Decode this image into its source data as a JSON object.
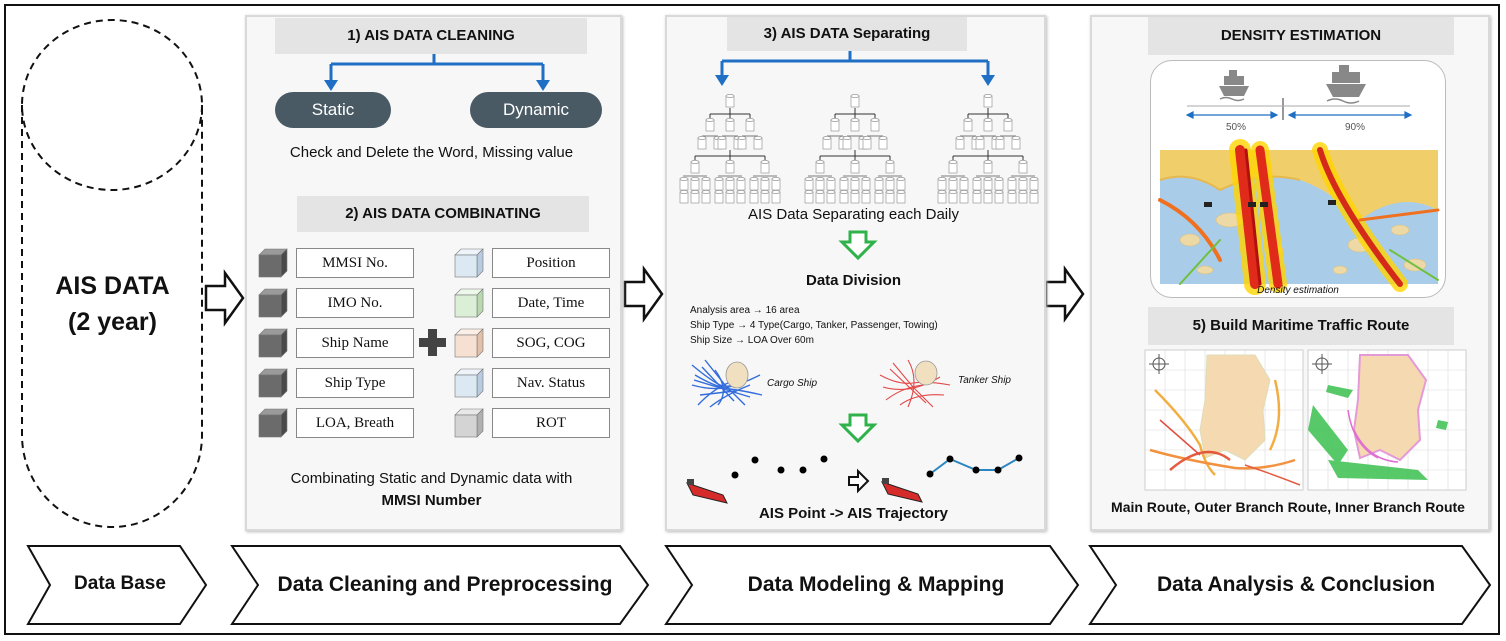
{
  "database": {
    "title_line1": "AIS DATA",
    "title_line2": "(2 year)"
  },
  "step1": {
    "header": "1)   AIS DATA CLEANING",
    "static_label": "Static",
    "dynamic_label": "Dynamic",
    "note": "Check and Delete the Word, Missing value"
  },
  "step2": {
    "header": "2) AIS DATA COMBINATING",
    "static_fields": [
      "MMSI No.",
      "IMO No.",
      "Ship Name",
      "Ship Type",
      "LOA, Breath"
    ],
    "dynamic_fields": [
      "Position",
      "Date, Time",
      "SOG, COG",
      "Nav. Status",
      "ROT"
    ],
    "footer_line1": "Combinating Static and Dynamic data with",
    "footer_line2": "MMSI Number"
  },
  "step3": {
    "header": "3) AIS DATA Separating",
    "tree_caption": "AIS Data Separating each Daily",
    "division_title": "Data Division",
    "division_lines": [
      "Analysis area → 16 area",
      "Ship Type → 4 Type(Cargo, Tanker, Passenger, Towing)",
      "Ship Size → LOA Over 60m"
    ],
    "cargo_label": "Cargo Ship",
    "tanker_label": "Tanker Ship",
    "trajectory_caption": "AIS Point -> AIS Trajectory"
  },
  "step4": {
    "header": "DENSITY ESTIMATION",
    "pct_left": "50%",
    "pct_right": "90%",
    "map_caption": "Density estimation"
  },
  "step5": {
    "header": "5) Build Maritime Traffic Route",
    "caption": "Main Route, Outer Branch Route, Inner Branch Route"
  },
  "stages": [
    "Data Base",
    "Data Cleaning and Preprocessing",
    "Data Modeling & Mapping",
    "Data Analysis & Conclusion"
  ],
  "colors": {
    "accent_blue": "#1f6fc4",
    "pill": "#4a5a64",
    "green_arrow": "#2fb24a",
    "ship_red": "#d62b2b"
  }
}
